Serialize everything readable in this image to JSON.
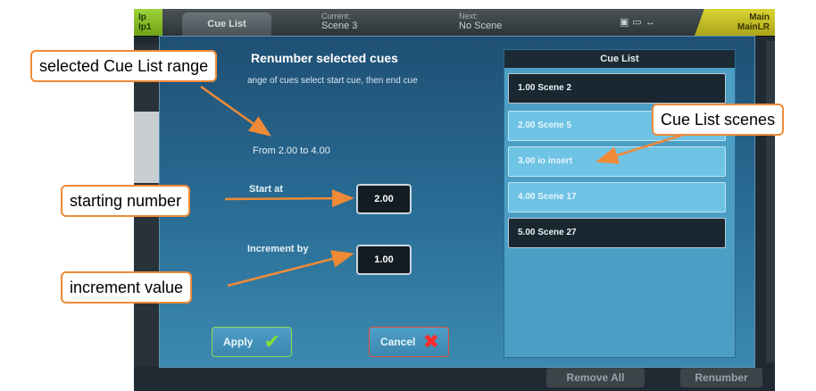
{
  "topbar": {
    "input_label_line1": "Ip",
    "input_label_line2": "Ip1",
    "active_tab": "Cue List",
    "current_label": "Current:",
    "current_value": "Scene 3",
    "next_label": "Next:",
    "next_value": "No Scene",
    "output_label_line1": "Main",
    "output_label_line2": "MainLR",
    "status_icons": [
      "camera-icon",
      "link-icon",
      "usb-icon"
    ]
  },
  "background": {
    "remove_all_label": "Remove All",
    "renumber_label": "Renumber"
  },
  "dialog": {
    "title": "Renumber selected cues",
    "subtitle": "ange of cues select start cue, then end cue",
    "range_text": "From 2.00 to 4.00",
    "start_label": "Start at",
    "start_value": "2.00",
    "increment_label": "Increment by",
    "increment_value": "1.00",
    "apply_label": "Apply",
    "cancel_label": "Cancel"
  },
  "cue_list": {
    "title": "Cue List",
    "items": [
      {
        "label": "1.00 Scene 2",
        "selected": false
      },
      {
        "label": "2.00 Scene 5",
        "selected": true
      },
      {
        "label": "3.00 io insert",
        "selected": true
      },
      {
        "label": "4.00 Scene 17",
        "selected": true
      },
      {
        "label": "5.00 Scene 27",
        "selected": false
      }
    ]
  },
  "annotations": {
    "range": "selected Cue List range",
    "scenes": "Cue List scenes",
    "starting": "starting number",
    "increment": "increment value"
  },
  "colors": {
    "annotation_border": "#ef8a37",
    "apply_border": "#8be04e",
    "cancel_border": "#e0513c",
    "dialog_top": "#1f4f74",
    "dialog_bottom": "#3c8ab0"
  }
}
